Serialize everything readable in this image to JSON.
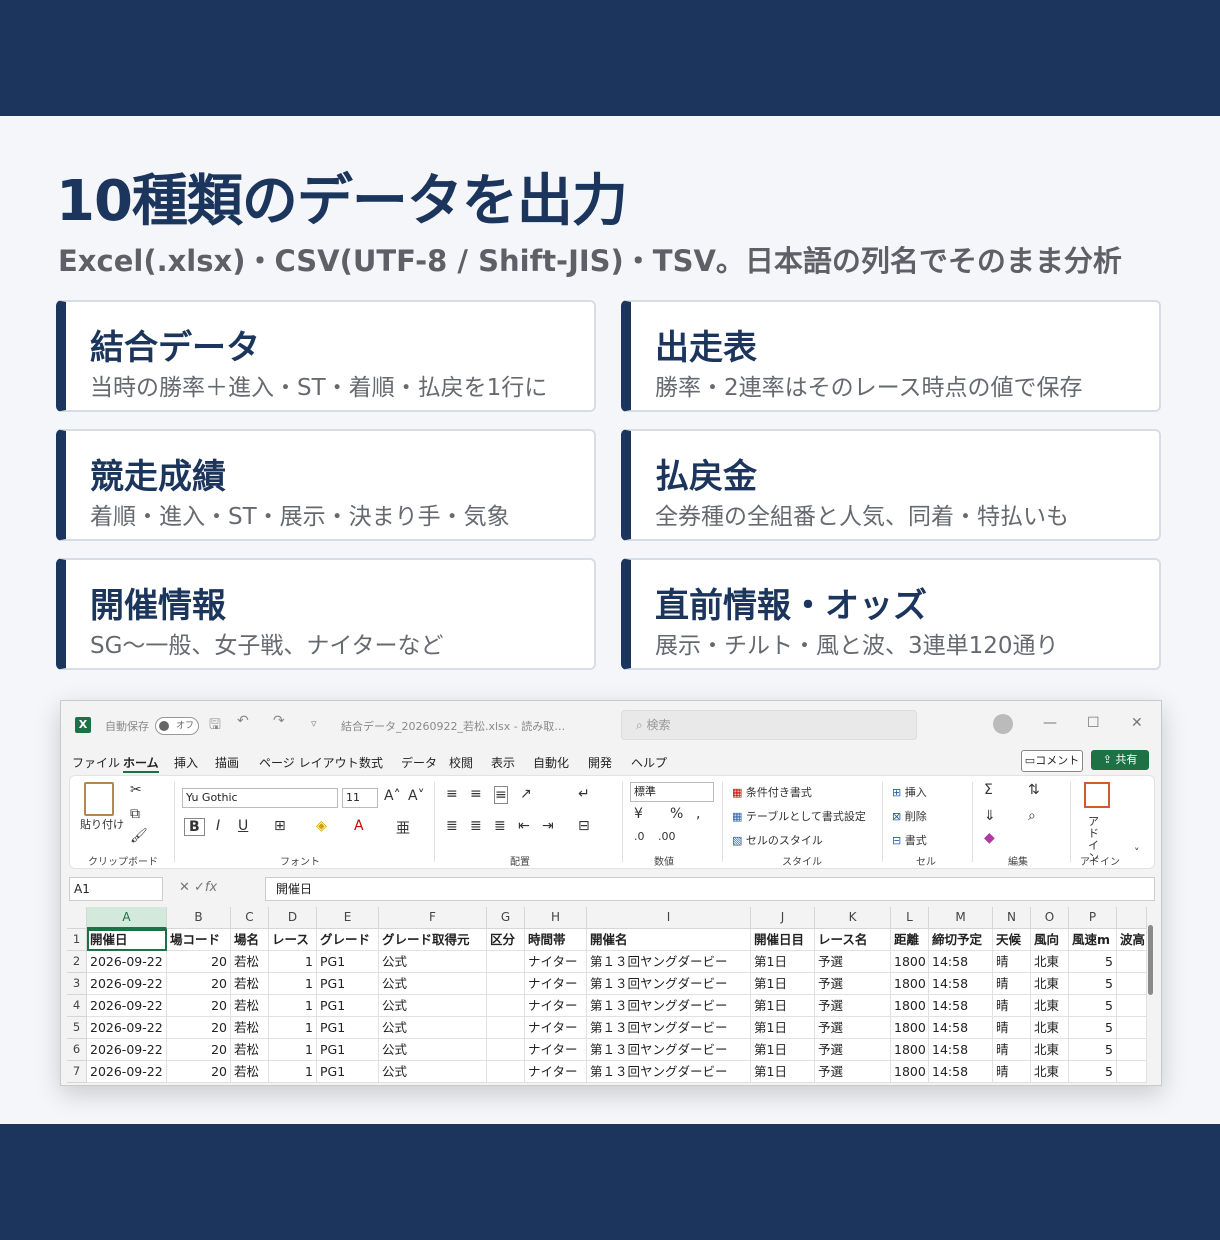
{
  "page": {
    "title": "10種類のデータを出力",
    "subtitle": "Excel(.xlsx)・CSV(UTF-8 / Shift-JIS)・TSV。日本語の列名でそのまま分析"
  },
  "cards": [
    {
      "title": "結合データ",
      "desc": "当時の勝率＋進入・ST・着順・払戻を1行に"
    },
    {
      "title": "出走表",
      "desc": "勝率・2連率はそのレース時点の値で保存"
    },
    {
      "title": "競走成績",
      "desc": "着順・進入・ST・展示・決まり手・気象"
    },
    {
      "title": "払戻金",
      "desc": "全券種の全組番と人気、同着・特払いも"
    },
    {
      "title": "開催情報",
      "desc": "SG〜一般、女子戦、ナイターなど"
    },
    {
      "title": "直前情報・オッズ",
      "desc": "展示・チルト・風と波、3連単120通り"
    }
  ],
  "excel": {
    "autosave_label": "自動保存",
    "autosave_state": "オフ",
    "filename": "結合データ_20260922_若松.xlsx - 読み取…",
    "search_placeholder": "検索",
    "menu": [
      "ファイル",
      "ホーム",
      "挿入",
      "描画",
      "ページ レイアウト",
      "数式",
      "データ",
      "校閲",
      "表示",
      "自動化",
      "開発",
      "ヘルプ"
    ],
    "comment_label": "コメント",
    "share_label": "共有",
    "ribbon": {
      "paste_label": "貼り付け",
      "clipboard_group": "クリップボード",
      "font_name": "Yu Gothic",
      "font_size": "11",
      "font_group": "フォント",
      "align_group": "配置",
      "number_format": "標準",
      "number_group": "数値",
      "cond_format": "条件付き書式",
      "table_format": "テーブルとして書式設定",
      "cell_style": "セルのスタイル",
      "style_group": "スタイル",
      "insert": "挿入",
      "delete": "削除",
      "format": "書式",
      "cells_group": "セル",
      "edit_group": "編集",
      "addin_label": "アド イン",
      "addin_group": "アドイン"
    },
    "name_box": "A1",
    "formula": "開催日",
    "columns": [
      "A",
      "B",
      "C",
      "D",
      "E",
      "F",
      "G",
      "H",
      "I",
      "J",
      "K",
      "L",
      "M",
      "N",
      "O",
      "P",
      ""
    ],
    "header_row": [
      "開催日",
      "場コード",
      "場名",
      "レース",
      "グレード",
      "グレード取得元",
      "区分",
      "時間帯",
      "開催名",
      "開催日目",
      "レース名",
      "距離",
      "締切予定",
      "天候",
      "風向",
      "風速m",
      "波高"
    ],
    "rows": [
      [
        "2026-09-22",
        "20",
        "若松",
        "1",
        "PG1",
        "公式",
        "",
        "ナイター",
        "第１３回ヤングダービー",
        "第1日",
        "予選",
        "1800",
        "14:58",
        "晴",
        "北東",
        "5",
        ""
      ],
      [
        "2026-09-22",
        "20",
        "若松",
        "1",
        "PG1",
        "公式",
        "",
        "ナイター",
        "第１３回ヤングダービー",
        "第1日",
        "予選",
        "1800",
        "14:58",
        "晴",
        "北東",
        "5",
        ""
      ],
      [
        "2026-09-22",
        "20",
        "若松",
        "1",
        "PG1",
        "公式",
        "",
        "ナイター",
        "第１３回ヤングダービー",
        "第1日",
        "予選",
        "1800",
        "14:58",
        "晴",
        "北東",
        "5",
        ""
      ],
      [
        "2026-09-22",
        "20",
        "若松",
        "1",
        "PG1",
        "公式",
        "",
        "ナイター",
        "第１３回ヤングダービー",
        "第1日",
        "予選",
        "1800",
        "14:58",
        "晴",
        "北東",
        "5",
        ""
      ],
      [
        "2026-09-22",
        "20",
        "若松",
        "1",
        "PG1",
        "公式",
        "",
        "ナイター",
        "第１３回ヤングダービー",
        "第1日",
        "予選",
        "1800",
        "14:58",
        "晴",
        "北東",
        "5",
        ""
      ],
      [
        "2026-09-22",
        "20",
        "若松",
        "1",
        "PG1",
        "公式",
        "",
        "ナイター",
        "第１３回ヤングダービー",
        "第1日",
        "予選",
        "1800",
        "14:58",
        "晴",
        "北東",
        "5",
        ""
      ]
    ],
    "row_numbers": [
      "1",
      "2",
      "3",
      "4",
      "5",
      "6",
      "7"
    ]
  },
  "colors": {
    "navy": "#1b355c",
    "excel_green": "#1e7145"
  }
}
